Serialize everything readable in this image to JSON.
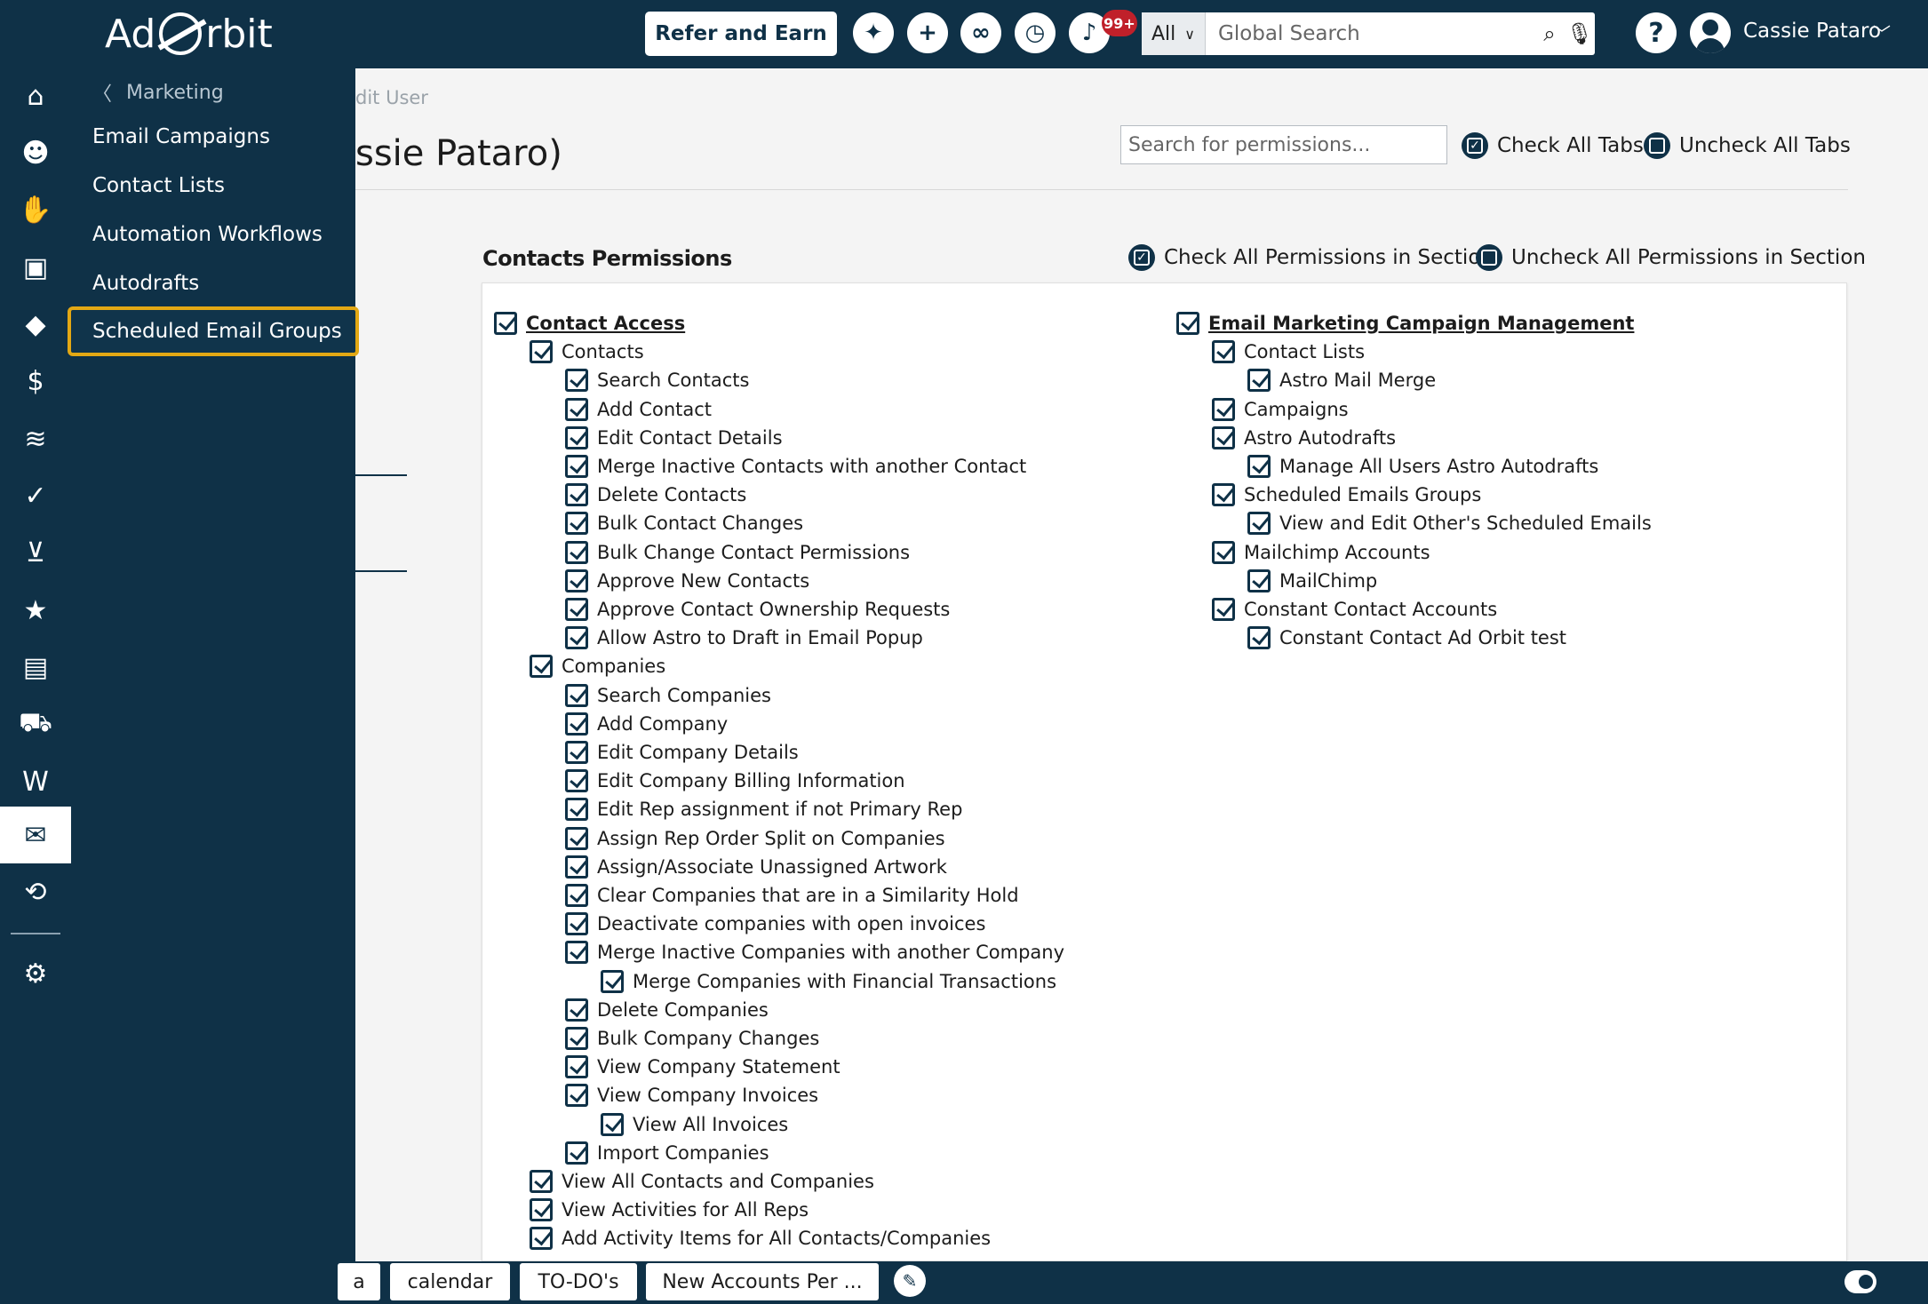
{
  "header": {
    "logo_left": "Ad",
    "logo_right": "rbit",
    "refer_label": "Refer and Earn",
    "notification_count": "99+",
    "search_scope": "All",
    "search_placeholder": "Global Search",
    "user_name": "Cassie Pataro"
  },
  "flyout": {
    "back_label": "Marketing",
    "items": [
      "Email Campaigns",
      "Contact Lists",
      "Automation Workflows",
      "Autodrafts",
      "Scheduled Email Groups"
    ]
  },
  "page": {
    "breadcrumb": "dit User",
    "title": "ssie Pataro)",
    "perm_search_placeholder": "Search for permissions...",
    "check_all_tabs": "Check All Tabs",
    "uncheck_all_tabs": "Uncheck All Tabs"
  },
  "section": {
    "title": "Contacts Permissions",
    "check_all": "Check All Permissions in Section",
    "uncheck_all": "Uncheck All Permissions in Section",
    "left_column": [
      "Contact Access",
      "Contacts",
      "Search Contacts",
      "Add Contact",
      "Edit Contact Details",
      "Merge Inactive Contacts with another Contact",
      "Delete Contacts",
      "Bulk Contact Changes",
      "Bulk Change Contact Permissions",
      "Approve New Contacts",
      "Approve Contact Ownership Requests",
      "Allow Astro to Draft in Email Popup",
      "Companies",
      "Search Companies",
      "Add Company",
      "Edit Company Details",
      "Edit Company Billing Information",
      "Edit Rep assignment if not Primary Rep",
      "Assign Rep Order Split on Companies",
      "Assign/Associate Unassigned Artwork",
      "Clear Companies that are in a Similarity Hold",
      "Deactivate companies with open invoices",
      "Merge Inactive Companies with another Company",
      "Merge Companies with Financial Transactions",
      "Delete Companies",
      "Bulk Company Changes",
      "View Company Statement",
      "View Company Invoices",
      "View All Invoices",
      "Import Companies",
      "View All Contacts and Companies",
      "View Activities for All Reps",
      "Add Activity Items for All Contacts/Companies"
    ],
    "right_column": [
      "Email Marketing Campaign Management",
      "Contact Lists",
      "Astro Mail Merge",
      "Campaigns",
      "Astro Autodrafts",
      "Manage All Users Astro Autodrafts",
      "Scheduled Emails Groups",
      "View and Edit Other's Scheduled Emails",
      "Mailchimp Accounts",
      "MailChimp",
      "Constant Contact Accounts",
      "Constant Contact Ad Orbit test"
    ]
  },
  "bottom_tabs": [
    "a",
    "calendar",
    "TO-DO's",
    "New Accounts Per ..."
  ],
  "colors": {
    "navy": "#0f3147",
    "highlight": "#e3a814",
    "badge": "#c0202a"
  },
  "icons": {
    "rail": [
      "home-icon",
      "contacts-icon",
      "handshake-icon",
      "gallery-icon",
      "ticket-icon",
      "invoice-icon",
      "billing-icon",
      "clipboard-icon",
      "cart-icon",
      "calendar-icon",
      "mailbox-icon",
      "truck-icon",
      "w2-icon",
      "mail-icon",
      "support-icon",
      "settings-icon"
    ]
  }
}
